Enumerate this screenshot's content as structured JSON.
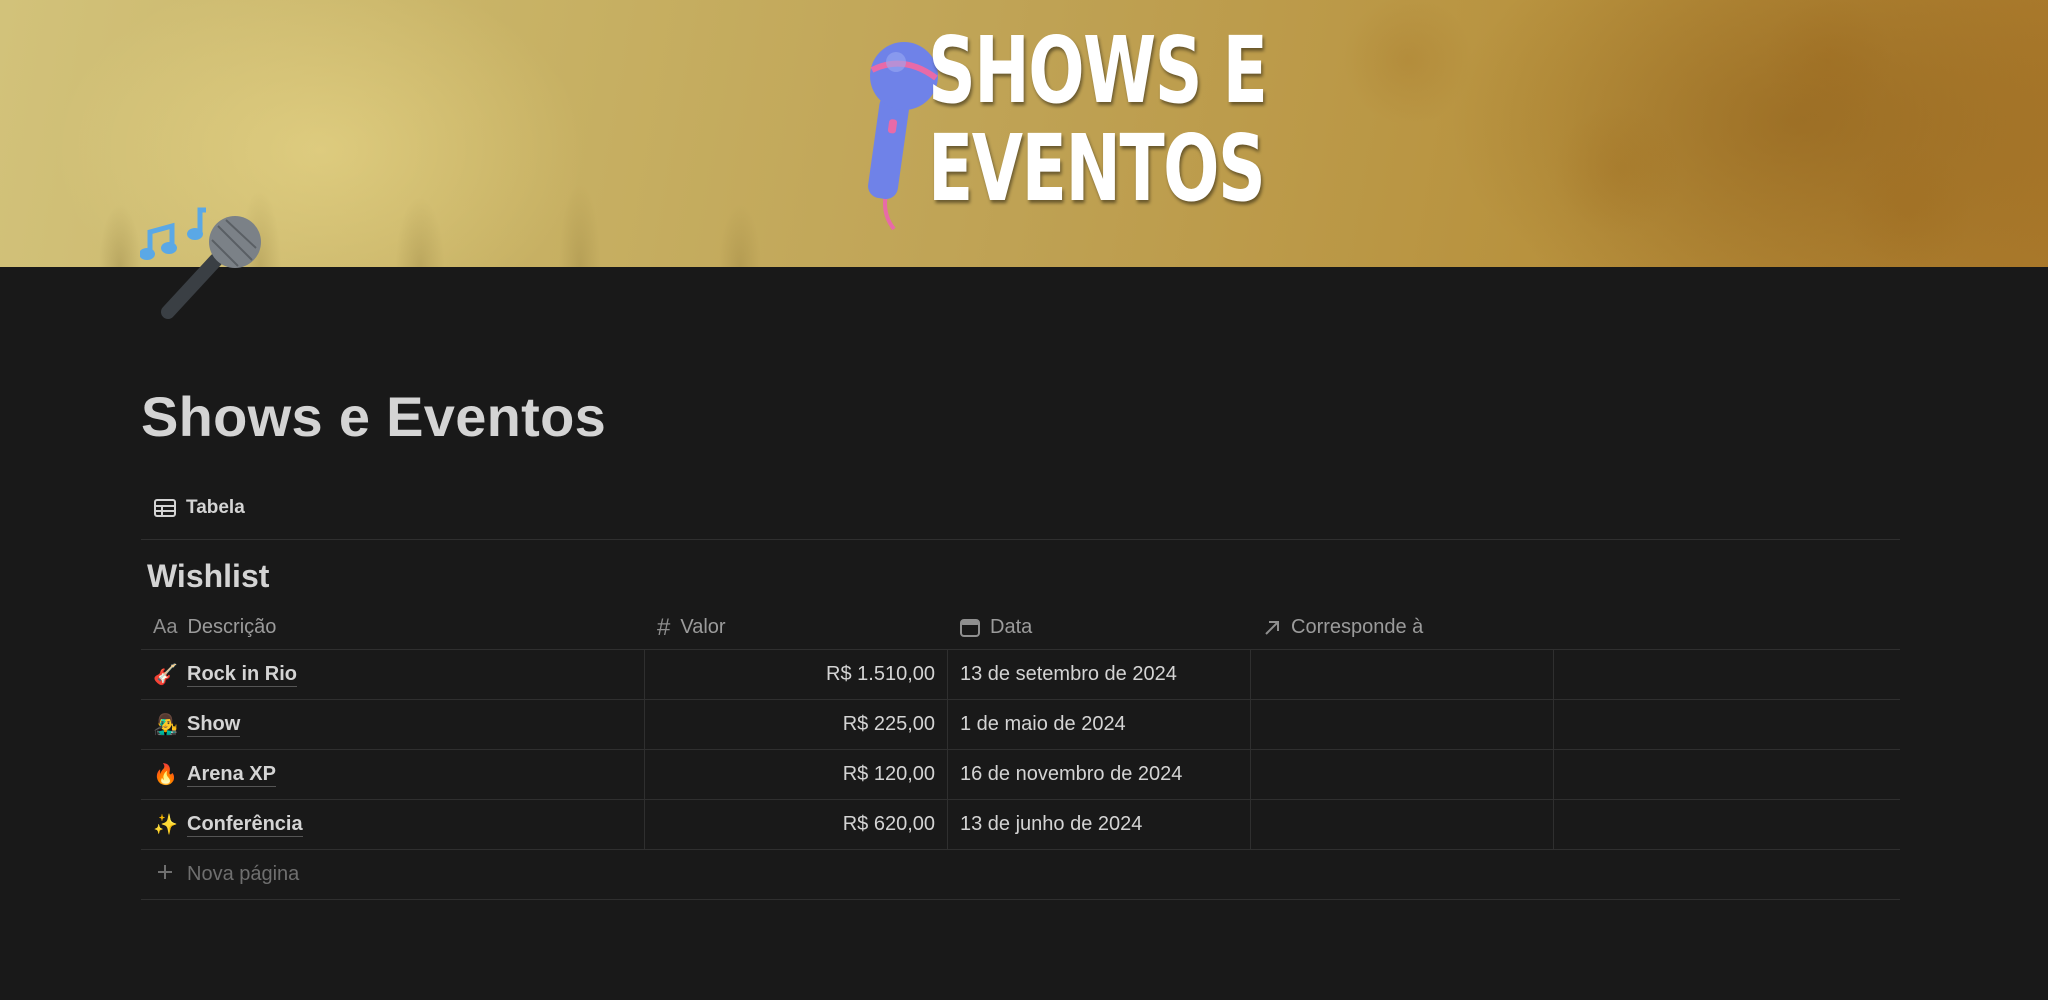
{
  "cover": {
    "title_line1": "SHOWS E",
    "title_line2": "EVENTOS",
    "icon": "microphone-icon"
  },
  "page": {
    "icon": "microphone-music-notes-icon",
    "title": "Shows e Eventos"
  },
  "view": {
    "tab_label": "Tabela",
    "tab_icon": "table-icon"
  },
  "database": {
    "title": "Wishlist",
    "columns": [
      {
        "label": "Descrição",
        "icon_text": "Aa",
        "icon": "text-type-icon"
      },
      {
        "label": "Valor",
        "icon_text": "#",
        "icon": "number-icon"
      },
      {
        "label": "Data",
        "icon": "calendar-icon"
      },
      {
        "label": "Corresponde à",
        "icon": "arrow-up-right-icon"
      }
    ],
    "rows": [
      {
        "icon": "guitar-icon",
        "emoji": "🎸",
        "name": "Rock in Rio",
        "valor": "R$ 1.510,00",
        "data": "13 de setembro de 2024"
      },
      {
        "icon": "singer-icon",
        "emoji": "👨‍🎤",
        "name": "Show",
        "valor": "R$ 225,00",
        "data": "1 de maio de 2024"
      },
      {
        "icon": "fire-icon",
        "emoji": "🔥",
        "name": "Arena XP",
        "valor": "R$ 120,00",
        "data": "16 de novembro de 2024"
      },
      {
        "icon": "sparkles-icon",
        "emoji": "✨",
        "name": "Conferência",
        "valor": "R$ 620,00",
        "data": "13 de junho de 2024"
      }
    ],
    "new_page_label": "Nova página"
  },
  "colors": {
    "background": "#191919",
    "text": "#d4d4d4",
    "muted": "#9b9b9b",
    "divider": "#2f2f2f"
  }
}
